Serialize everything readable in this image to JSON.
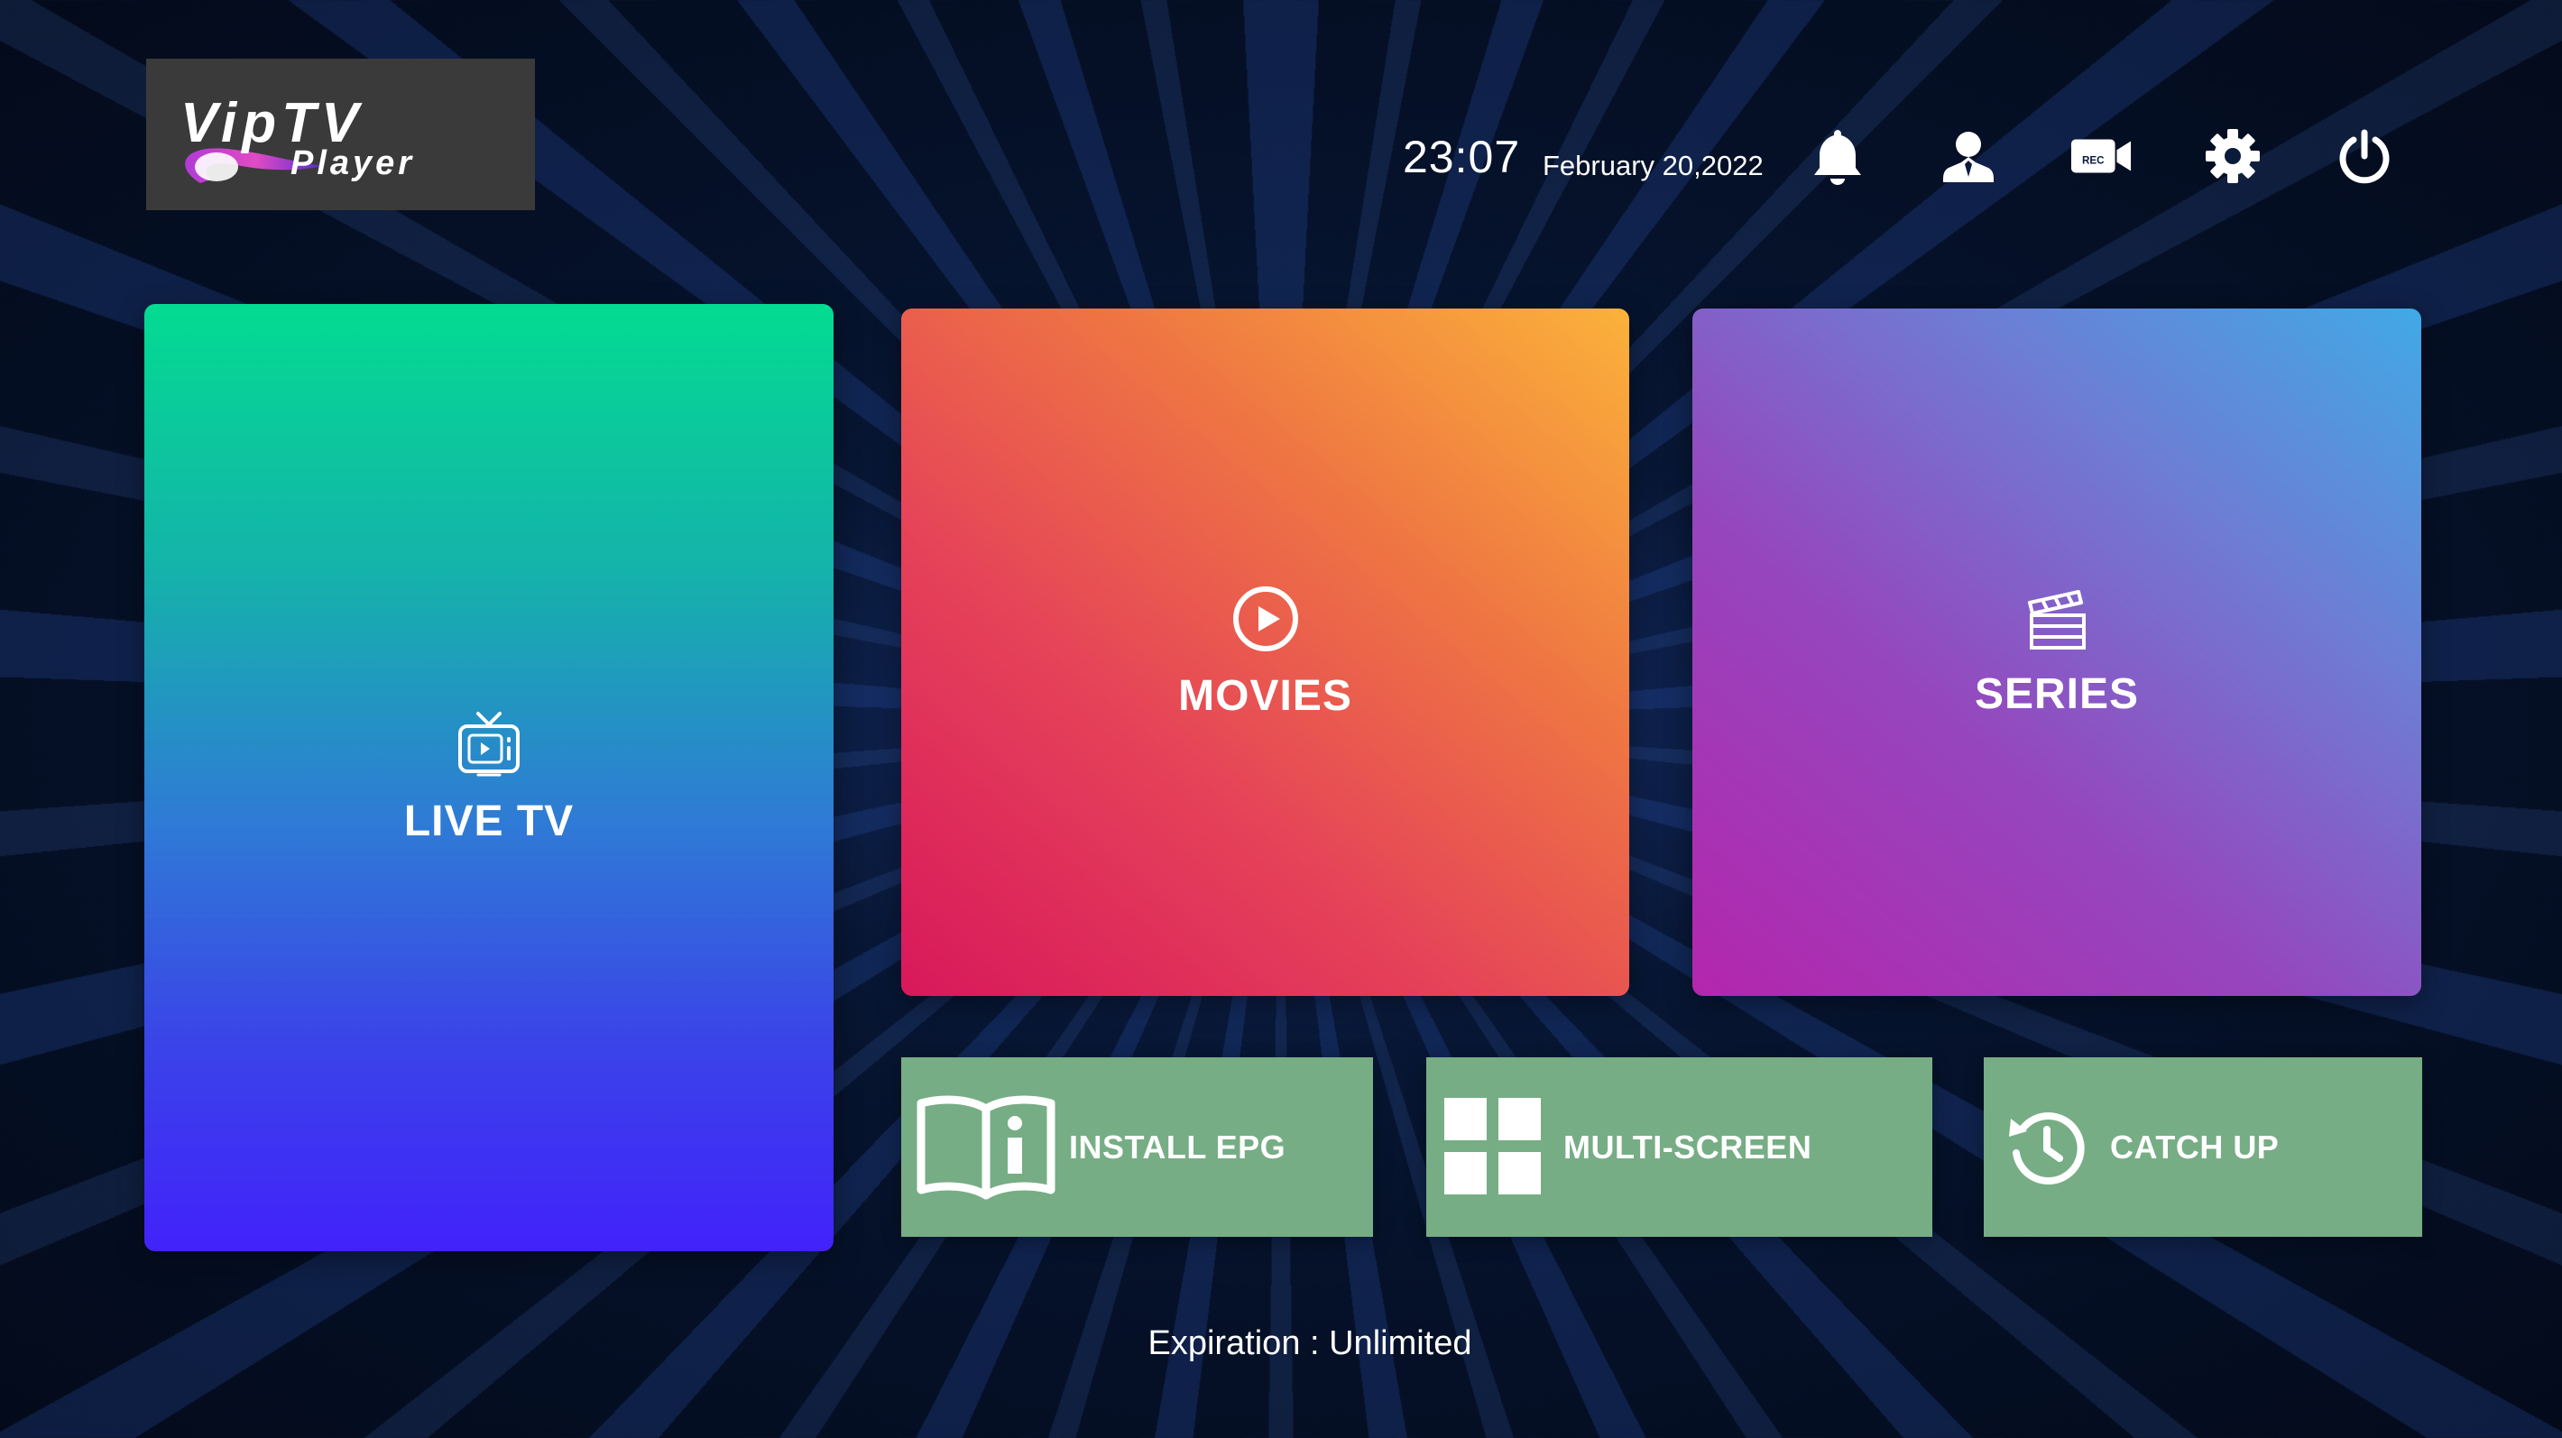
{
  "app": {
    "logo_line1": "VipTV",
    "logo_line2": "Player"
  },
  "header": {
    "time": "23:07",
    "date": "February 20,2022",
    "icons": [
      "bell-icon",
      "user-icon",
      "rec-camera-icon",
      "gear-icon",
      "power-icon"
    ],
    "rec_badge": "REC"
  },
  "tiles": {
    "live_tv": {
      "label": "LIVE TV",
      "icon": "tv-icon",
      "colors": [
        "#03db91",
        "#4222fb"
      ]
    },
    "movies": {
      "label": "MOVIES",
      "icon": "play-circle-icon",
      "colors": [
        "#d8185b",
        "#fbb23a"
      ]
    },
    "series": {
      "label": "SERIES",
      "icon": "clapperboard-icon",
      "colors": [
        "#b326ad",
        "#41a9e6"
      ]
    }
  },
  "actions": {
    "install_epg": {
      "label": "INSTALL EPG",
      "icon": "book-info-icon"
    },
    "multi_screen": {
      "label": "MULTI-SCREEN",
      "icon": "grid-icon"
    },
    "catch_up": {
      "label": "CATCH UP",
      "icon": "history-icon"
    },
    "color": "#76ad85"
  },
  "footer": {
    "expiration": "Expiration : Unlimited"
  }
}
